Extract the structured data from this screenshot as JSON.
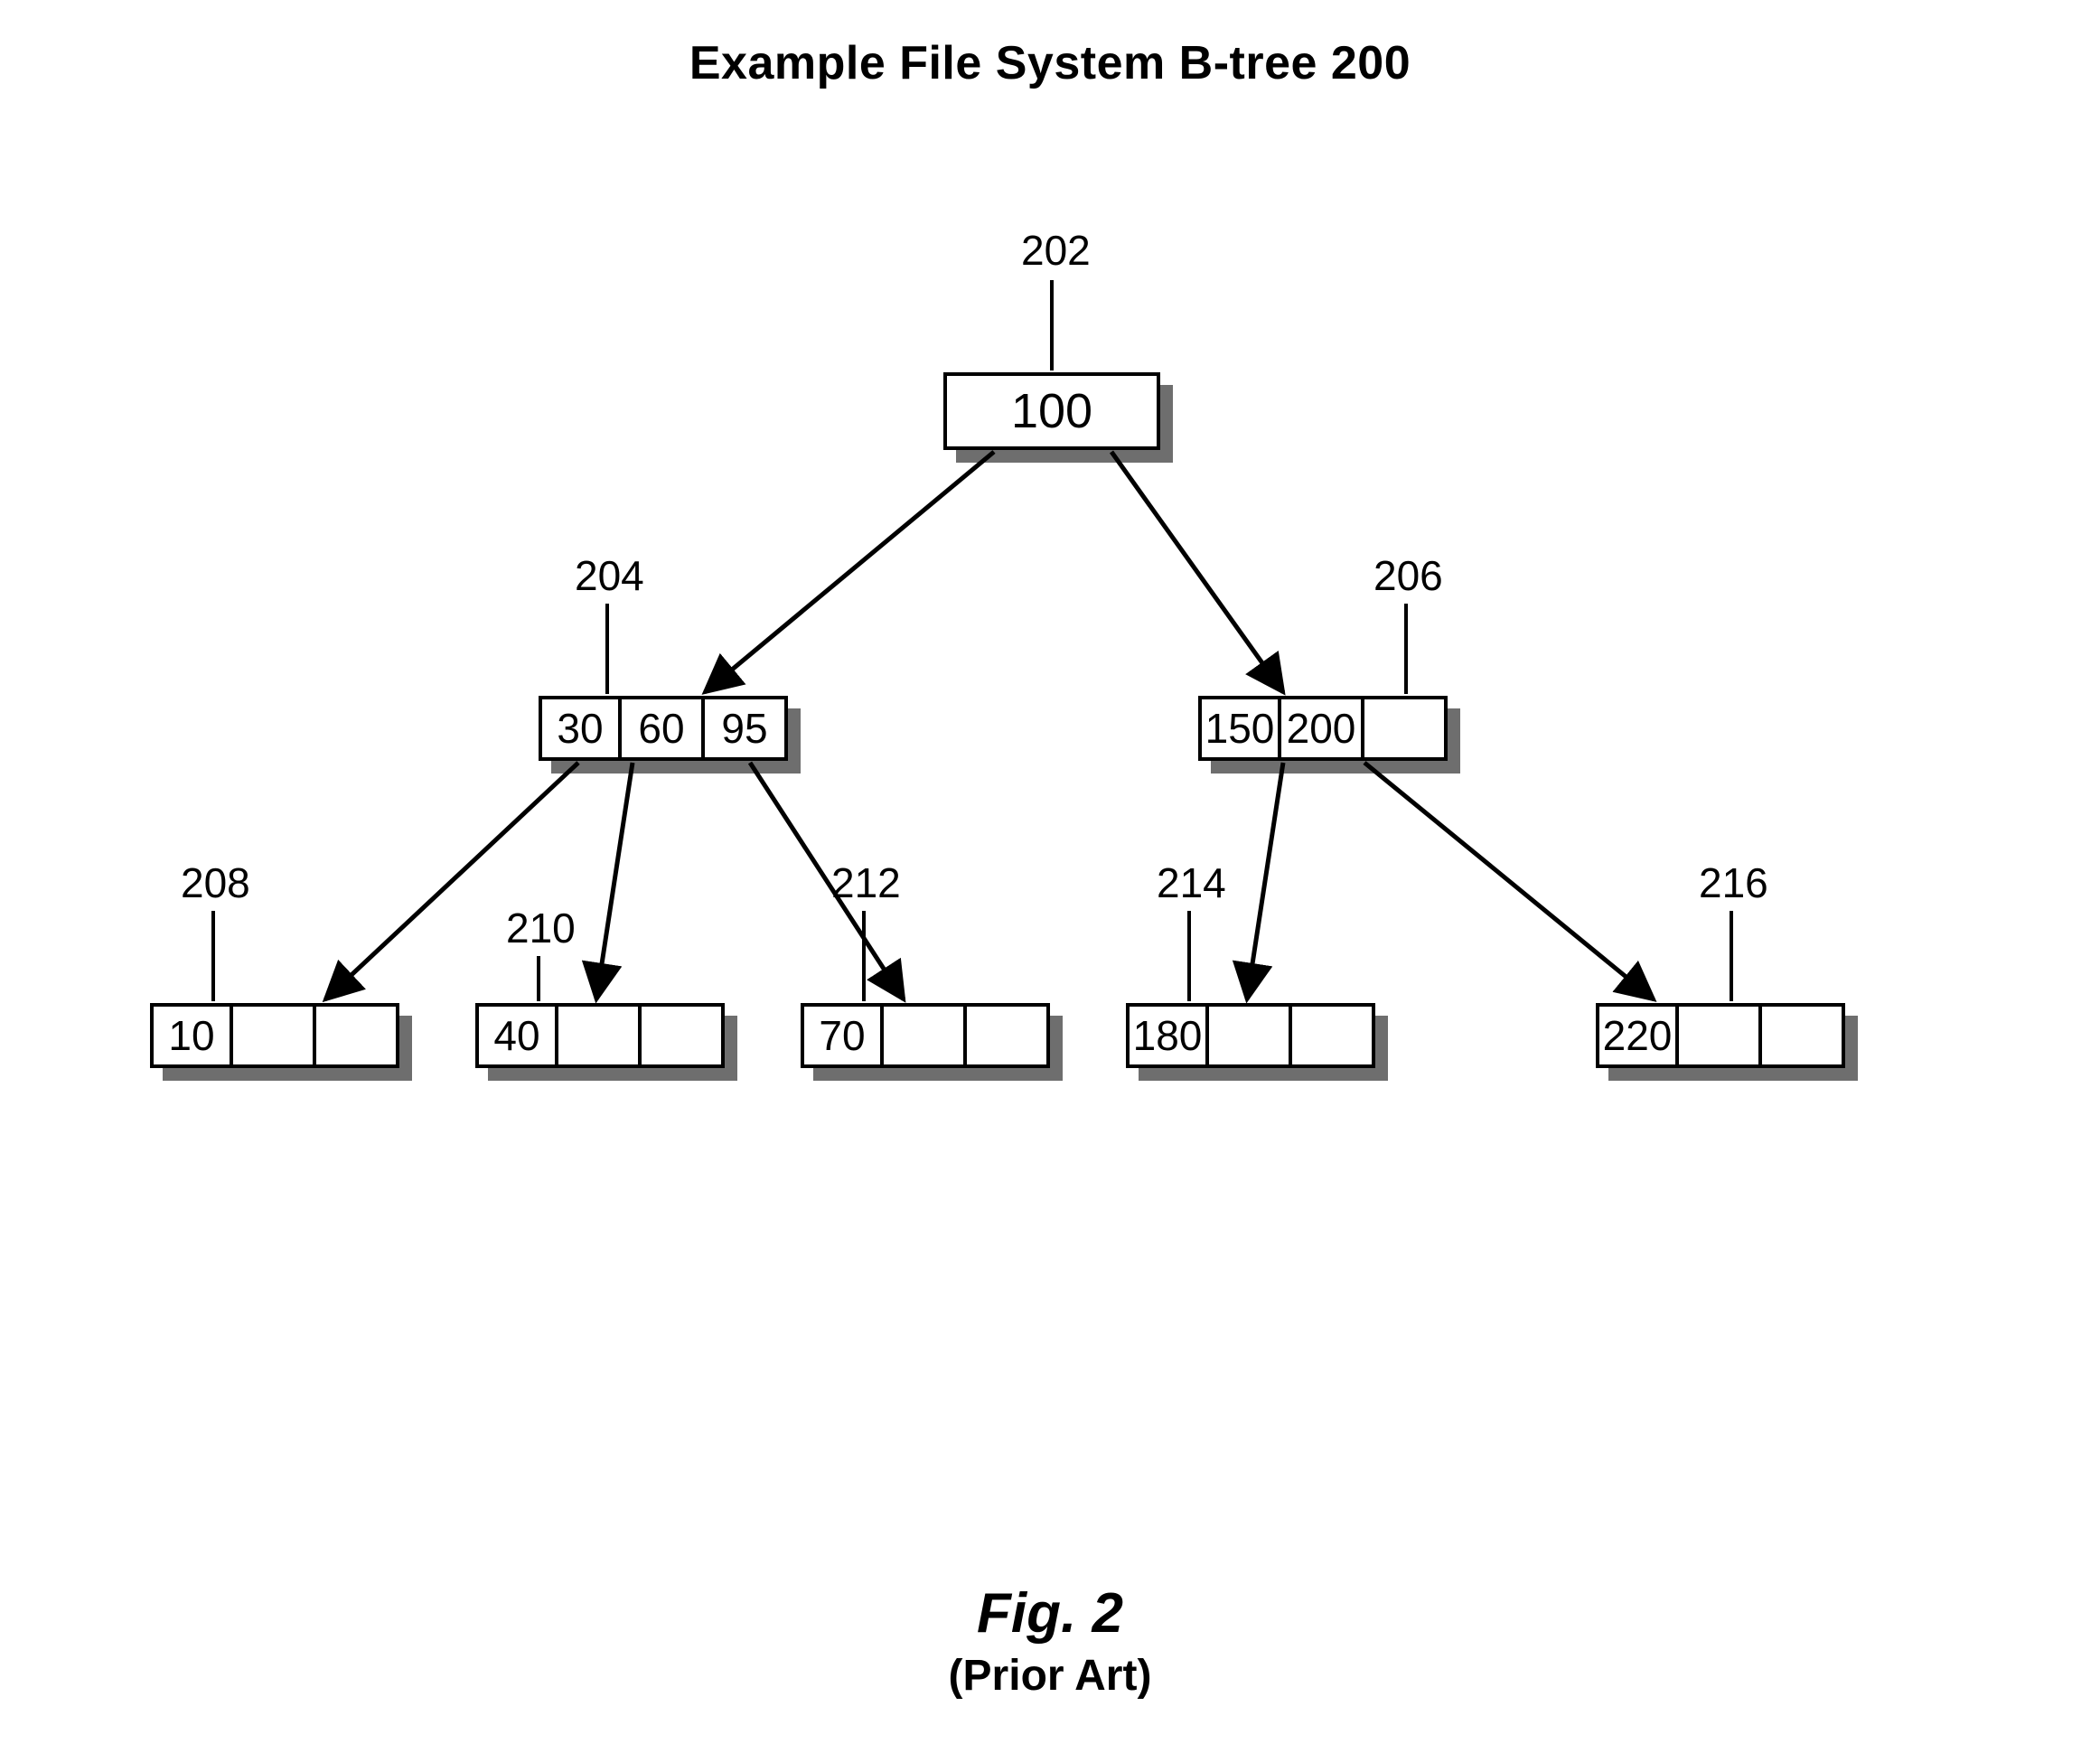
{
  "title": "Example File System B-tree 200",
  "figure": {
    "label": "Fig. 2",
    "subtitle": "(Prior Art)"
  },
  "refs": {
    "root": "202",
    "mid_left": "204",
    "mid_right": "206",
    "leaf_a": "208",
    "leaf_b": "210",
    "leaf_c": "212",
    "leaf_d": "214",
    "leaf_e": "216"
  },
  "nodes": {
    "root": [
      "100"
    ],
    "mid_left": [
      "30",
      "60",
      "95"
    ],
    "mid_right": [
      "150",
      "200",
      ""
    ],
    "leaf_a": [
      "10",
      "",
      ""
    ],
    "leaf_b": [
      "40",
      "",
      ""
    ],
    "leaf_c": [
      "70",
      "",
      ""
    ],
    "leaf_d": [
      "180",
      "",
      ""
    ],
    "leaf_e": [
      "220",
      "",
      ""
    ]
  }
}
